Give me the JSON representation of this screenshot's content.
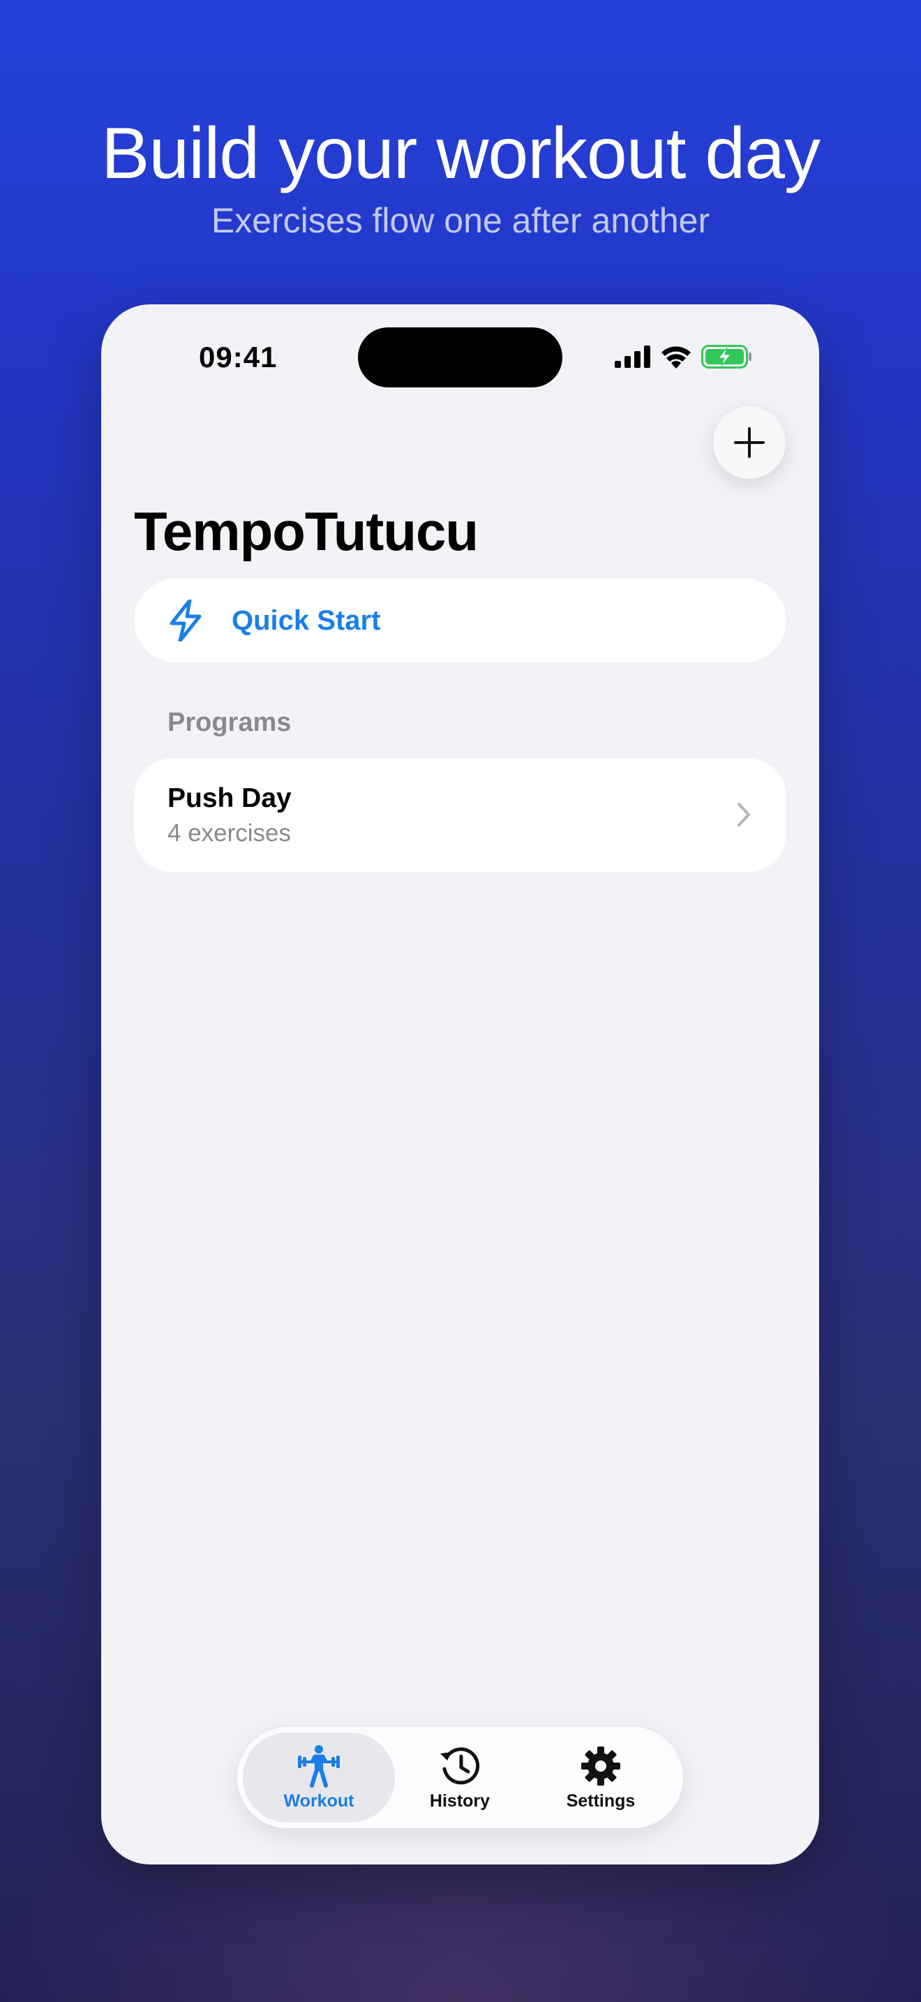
{
  "promo": {
    "headline": "Build your workout day",
    "subheadline": "Exercises flow one after another"
  },
  "status_bar": {
    "time": "09:41",
    "icons": [
      "cellular-signal-icon",
      "wifi-icon",
      "battery-charging-icon"
    ]
  },
  "app": {
    "title": "TempoTutucu",
    "add_button_icon": "plus-icon",
    "quick_start": {
      "label": "Quick Start",
      "icon": "bolt-icon"
    },
    "programs_section": {
      "title": "Programs",
      "items": [
        {
          "name": "Push Day",
          "subtitle": "4 exercises",
          "icon": "chevron-right-icon"
        }
      ]
    }
  },
  "tab_bar": {
    "tabs": [
      {
        "label": "Workout",
        "icon": "weightlifter-icon",
        "active": true
      },
      {
        "label": "History",
        "icon": "history-clock-icon",
        "active": false
      },
      {
        "label": "Settings",
        "icon": "gear-icon",
        "active": false
      }
    ]
  },
  "colors": {
    "accent": "#1a7ee6",
    "background_top": "#2441da",
    "background_bottom": "#232154",
    "screen_background": "#f2f2f7",
    "battery_green": "#34c759"
  }
}
